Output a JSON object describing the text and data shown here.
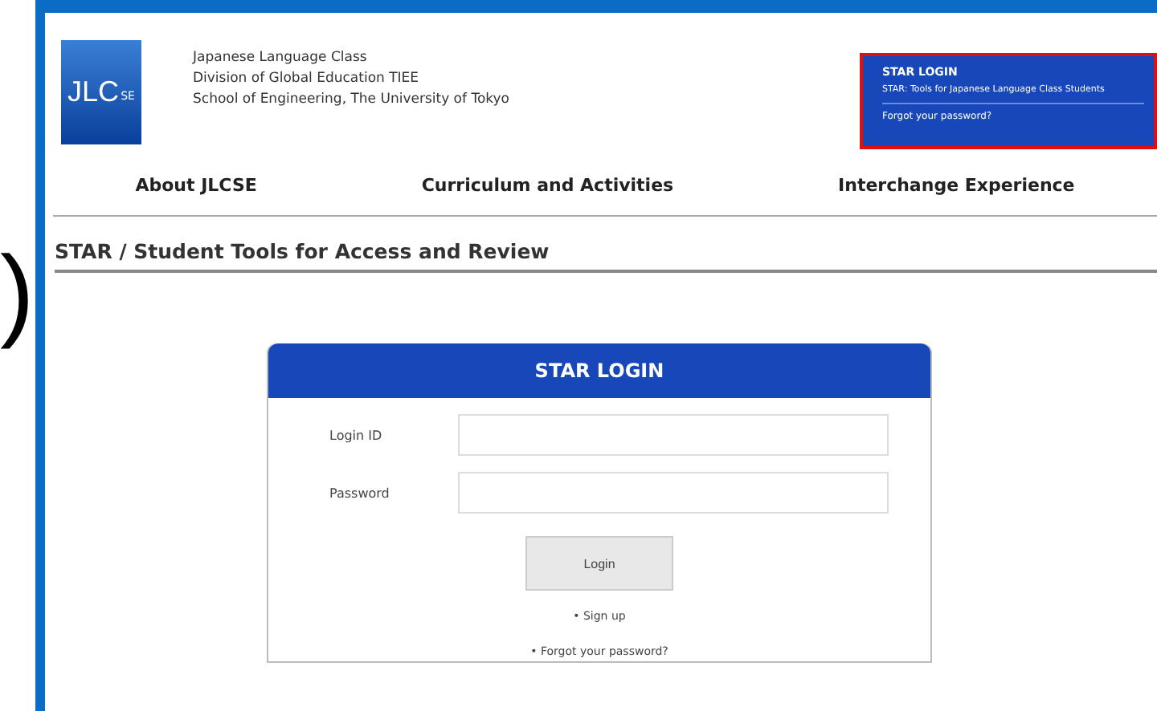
{
  "outside_fragment": ")",
  "header": {
    "logo": {
      "main": "JLC",
      "sub": "SE"
    },
    "org_lines": [
      "Japanese Language Class",
      "Division of Global Education TIEE",
      "School of Engineering, The University of Tokyo"
    ],
    "star_box": {
      "title": "STAR LOGIN",
      "subtitle": "STAR: Tools for Japanese Language Class Students",
      "link": "Forgot your password?",
      "highlighted": true
    }
  },
  "nav": [
    {
      "label": "About JLCSE"
    },
    {
      "label": "Curriculum and Activities"
    },
    {
      "label": "Interchange Experience"
    }
  ],
  "page_title": "STAR / Student Tools for Access and Review",
  "login": {
    "title": "STAR LOGIN",
    "fields": [
      {
        "label": "Login ID"
      },
      {
        "label": "Password"
      }
    ],
    "button": "Login",
    "links": [
      "• Sign up",
      "• Forgot your password?"
    ]
  }
}
